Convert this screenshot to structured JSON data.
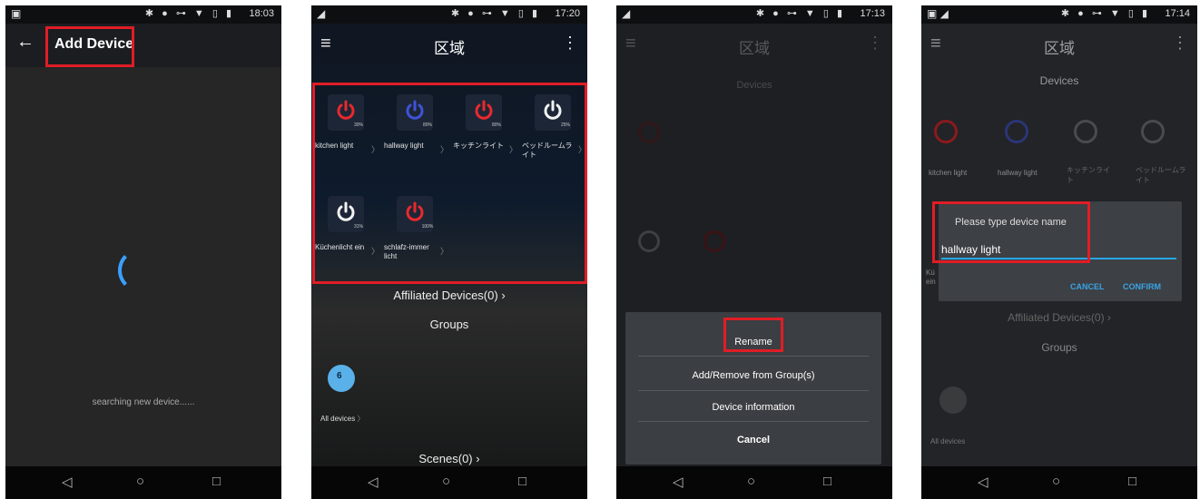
{
  "status_times": [
    "18:03",
    "17:20",
    "17:13",
    "17:14"
  ],
  "status_icons": "✱ ● ⊶ ▼ ▯ ▮",
  "nav": {
    "back": "◁",
    "home": "○",
    "recent": "□"
  },
  "screen1": {
    "back_icon": "←",
    "title": "Add Device",
    "searching_text": "searching new device......"
  },
  "screen2": {
    "title": "区域",
    "devices": [
      {
        "name": "kitchen light",
        "percent": "30%",
        "color": "#e8292e"
      },
      {
        "name": "hallway light",
        "percent": "80%",
        "color": "#3f52d6"
      },
      {
        "name": "キッチンライト",
        "percent": "80%",
        "color": "#e8292e"
      },
      {
        "name": "ベッドルームライト",
        "percent": "25%",
        "color": "#f2f2f2"
      },
      {
        "name": "Küchenlicht ein",
        "percent": "31%",
        "color": "#f2f2f2"
      },
      {
        "name": "schlafz-immer licht",
        "percent": "100%",
        "color": "#e8292e"
      }
    ],
    "affiliated": "Affiliated Devices(0)",
    "groups_title": "Groups",
    "group_count": "6",
    "all_devices": "All devices",
    "scenes": "Scenes(0)"
  },
  "screen3": {
    "title": "区域",
    "section": "Devices",
    "options": [
      "Rename",
      "Add/Remove from Group(s)",
      "Device information",
      "Cancel"
    ]
  },
  "screen4": {
    "title": "区域",
    "section": "Devices",
    "dialog_title": "Please type device name",
    "input_value": "hallway light",
    "cancel": "CANCEL",
    "confirm": "CONFIRM",
    "affiliated": "Affiliated Devices(0)",
    "groups_title": "Groups",
    "all_devices": "All devices",
    "device_names": [
      "kitchen light",
      "hallway light",
      "キッチンライト",
      "ベッドルームライト",
      "Kü",
      "ein"
    ]
  },
  "colors": {
    "highlight": "#e01d26",
    "accent_blue": "#3aa4e6",
    "spinner": "#3aa0ff"
  }
}
